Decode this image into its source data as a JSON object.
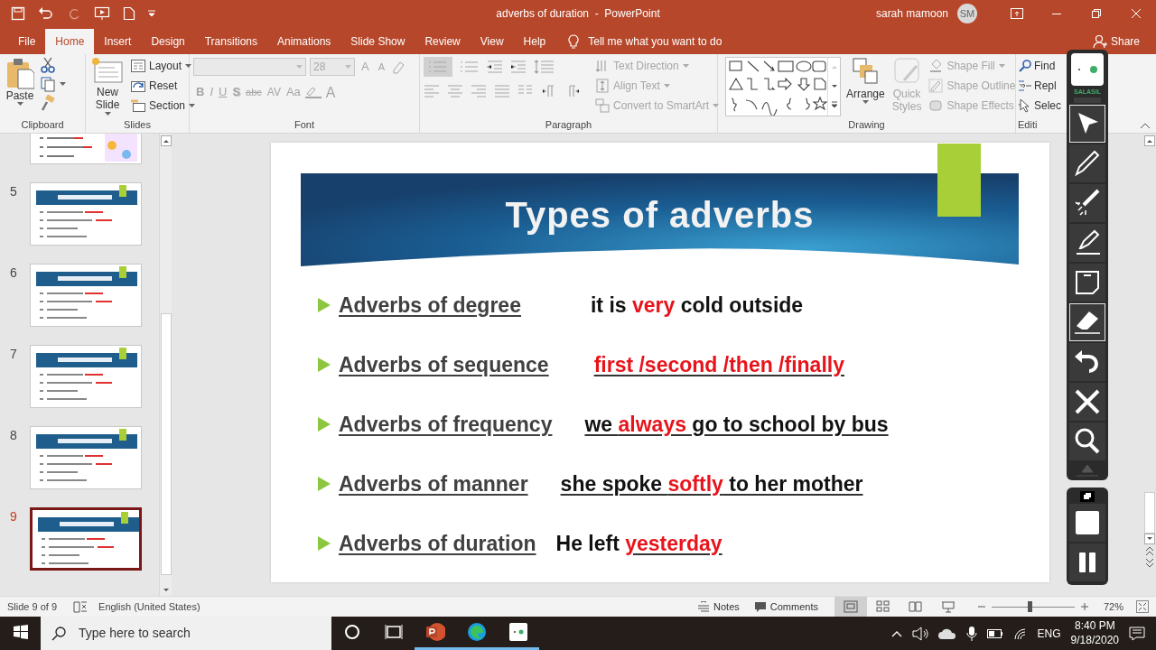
{
  "title_bar": {
    "title": "adverbs of duration  -  PowerPoint",
    "user": "sarah mamoon",
    "initials": "SM"
  },
  "menu_tabs": [
    {
      "label": "File",
      "selected": false
    },
    {
      "label": "Home",
      "selected": true
    },
    {
      "label": "Insert",
      "selected": false
    },
    {
      "label": "Design",
      "selected": false
    },
    {
      "label": "Transitions",
      "selected": false
    },
    {
      "label": "Animations",
      "selected": false
    },
    {
      "label": "Slide Show",
      "selected": false
    },
    {
      "label": "Review",
      "selected": false
    },
    {
      "label": "View",
      "selected": false
    },
    {
      "label": "Help",
      "selected": false
    }
  ],
  "tell_me": {
    "placeholder": "Tell me what you want to do"
  },
  "share": "Share",
  "ribbon": {
    "clipboard": {
      "label": "Clipboard",
      "paste": "Paste"
    },
    "slides": {
      "label": "Slides",
      "new_slide": "New Slide",
      "commands": [
        {
          "label": "Layout",
          "dropdown": true
        },
        {
          "label": "Reset",
          "dropdown": false
        },
        {
          "label": "Section",
          "dropdown": true
        }
      ]
    },
    "font": {
      "label": "Font",
      "disabled": true,
      "size": "28",
      "grow": "A",
      "shrink": "A",
      "styles": [
        "B",
        "I",
        "U",
        "S",
        "abc",
        "AV",
        "Aa"
      ],
      "color_button": "A"
    },
    "paragraph": {
      "label": "Paragraph",
      "disabled": true,
      "commands": [
        "Text Direction",
        "Align Text",
        "Convert to SmartArt"
      ]
    },
    "drawing": {
      "label": "Drawing",
      "arrange": "Arrange",
      "quick_styles": {
        "label": "Quick Styles",
        "disabled": true
      },
      "commands": [
        {
          "label": "Shape Fill",
          "disabled": true
        },
        {
          "label": "Shape Outline",
          "disabled": true
        },
        {
          "label": "Shape Effects",
          "disabled": true
        }
      ]
    },
    "editing": {
      "label": "Editi",
      "commands": [
        "Find",
        "Repl",
        "Selec"
      ]
    }
  },
  "thumbnails": [
    {
      "kind": "partial",
      "selected": false
    },
    {
      "kind": "full",
      "number": "5",
      "selected": false
    },
    {
      "kind": "full",
      "number": "6",
      "selected": false
    },
    {
      "kind": "full",
      "number": "7",
      "selected": false
    },
    {
      "kind": "full",
      "number": "8",
      "selected": false
    },
    {
      "kind": "full",
      "number": "9",
      "selected": true
    }
  ],
  "slide": {
    "title": "Types of adverbs",
    "items": [
      {
        "label": "Adverbs of degree",
        "example": [
          {
            "text": "it is ",
            "emphasis": false,
            "underlined": false
          },
          {
            "text": "very",
            "emphasis": true,
            "underlined": false
          },
          {
            "text": " cold outside",
            "emphasis": false,
            "underlined": false
          }
        ]
      },
      {
        "label": "Adverbs of sequence",
        "example": [
          {
            "text": "first /second /then /finally",
            "emphasis": true,
            "underlined": true
          }
        ]
      },
      {
        "label": "Adverbs of frequency",
        "example": [
          {
            "text": "we ",
            "emphasis": false,
            "underlined": true
          },
          {
            "text": "always",
            "emphasis": true,
            "underlined": true
          },
          {
            "text": " go to school by bus",
            "emphasis": false,
            "underlined": true
          }
        ]
      },
      {
        "label": "Adverbs of manner",
        "example": [
          {
            "text": "she spoke ",
            "emphasis": false,
            "underlined": true
          },
          {
            "text": "softly",
            "emphasis": true,
            "underlined": true
          },
          {
            "text": " to her mother",
            "emphasis": false,
            "underlined": true
          }
        ]
      },
      {
        "label": "Adverbs of duration",
        "example": [
          {
            "text": "He left ",
            "emphasis": false,
            "underlined": false
          },
          {
            "text": "yesterday",
            "emphasis": true,
            "underlined": true
          }
        ]
      }
    ]
  },
  "annotation_toolbar": {
    "brand": "SALASIL",
    "tools": [
      {
        "kind": "pointer",
        "selected": true
      },
      {
        "kind": "pen",
        "selected": false
      },
      {
        "kind": "laser",
        "selected": false
      },
      {
        "kind": "highlighter",
        "selected": false
      },
      {
        "kind": "note",
        "selected": false
      },
      {
        "kind": "eraser",
        "selected": true
      },
      {
        "kind": "undo",
        "selected": false
      },
      {
        "kind": "clear",
        "selected": false
      },
      {
        "kind": "zoom",
        "selected": false
      }
    ]
  },
  "status_bar": {
    "slide_info": "Slide 9 of 9",
    "language": "English (United States)",
    "notes": "Notes",
    "comments": "Comments",
    "views": [
      {
        "kind": "normal",
        "selected": true
      },
      {
        "kind": "sorter",
        "selected": false
      },
      {
        "kind": "reading",
        "selected": false
      },
      {
        "kind": "slideshow",
        "selected": false
      }
    ],
    "zoom": {
      "level": 0.46,
      "reading": "72%"
    }
  },
  "taskbar": {
    "search": {
      "placeholder": "Type here to search"
    },
    "apps": [
      {
        "kind": "powerpoint",
        "running": true
      },
      {
        "kind": "edge",
        "running": true
      },
      {
        "kind": "salasil",
        "running": true
      }
    ],
    "language": "ENG",
    "time": "8:40 PM",
    "date": "9/18/2020"
  }
}
